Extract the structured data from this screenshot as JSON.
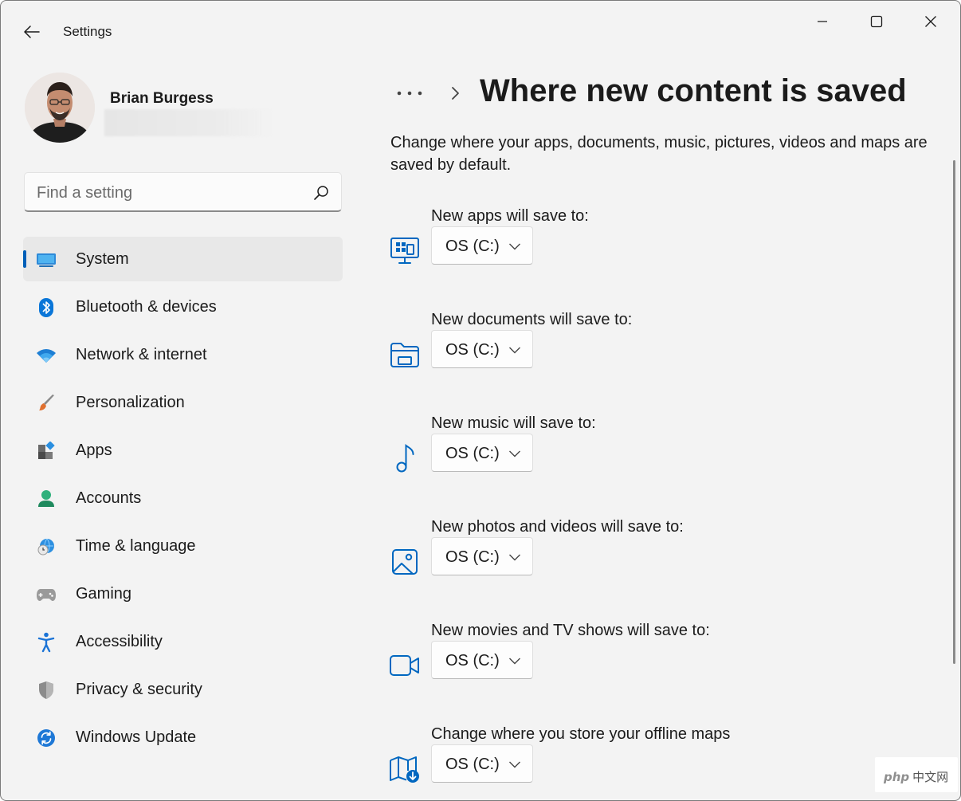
{
  "app": {
    "title": "Settings"
  },
  "profile": {
    "name": "Brian Burgess"
  },
  "search": {
    "placeholder": "Find a setting"
  },
  "sidebar": {
    "items": [
      {
        "label": "System",
        "icon": "monitor-icon",
        "active": true
      },
      {
        "label": "Bluetooth & devices",
        "icon": "bluetooth-icon"
      },
      {
        "label": "Network & internet",
        "icon": "wifi-icon"
      },
      {
        "label": "Personalization",
        "icon": "paintbrush-icon"
      },
      {
        "label": "Apps",
        "icon": "apps-icon"
      },
      {
        "label": "Accounts",
        "icon": "person-icon"
      },
      {
        "label": "Time & language",
        "icon": "globe-clock-icon"
      },
      {
        "label": "Gaming",
        "icon": "gamepad-icon"
      },
      {
        "label": "Accessibility",
        "icon": "accessibility-icon"
      },
      {
        "label": "Privacy & security",
        "icon": "shield-icon"
      },
      {
        "label": "Windows Update",
        "icon": "sync-icon"
      }
    ]
  },
  "main": {
    "breadcrumb_more": "•••",
    "title": "Where new content is saved",
    "description": "Change where your apps, documents, music, pictures, videos and maps are saved by default.",
    "rows": [
      {
        "label": "New apps will save to:",
        "value": "OS (C:)",
        "icon": "apps-monitor-icon"
      },
      {
        "label": "New documents will save to:",
        "value": "OS (C:)",
        "icon": "folder-icon"
      },
      {
        "label": "New music will save to:",
        "value": "OS (C:)",
        "icon": "music-note-icon"
      },
      {
        "label": "New photos and videos will save to:",
        "value": "OS (C:)",
        "icon": "image-icon"
      },
      {
        "label": "New movies and TV shows will save to:",
        "value": "OS (C:)",
        "icon": "video-camera-icon"
      },
      {
        "label": "Change where you store your offline maps",
        "value": "OS (C:)",
        "icon": "map-download-icon"
      }
    ]
  },
  "watermark": {
    "logo": "php",
    "text": "中文网"
  },
  "colors": {
    "accent": "#005fb8",
    "icon_blue": "#0067c0",
    "window_bg": "#f3f3f3"
  }
}
